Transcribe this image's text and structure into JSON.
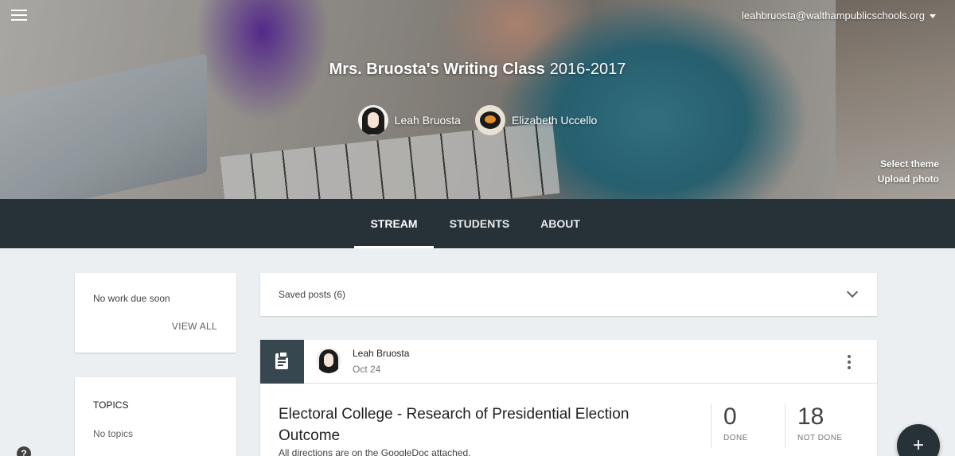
{
  "header": {
    "account_email": "leahbruosta@walthampublicschools.org",
    "class_name": "Mrs. Bruosta's Writing Class",
    "class_section": "2016-2017",
    "teachers": [
      {
        "name": "Leah Bruosta"
      },
      {
        "name": "Elizabeth Uccello"
      }
    ],
    "select_theme": "Select theme",
    "upload_photo": "Upload photo"
  },
  "tabs": [
    {
      "label": "STREAM",
      "active": true
    },
    {
      "label": "STUDENTS",
      "active": false
    },
    {
      "label": "ABOUT",
      "active": false
    }
  ],
  "upcoming": {
    "text": "No work due soon",
    "view_all": "VIEW ALL"
  },
  "topics": {
    "heading": "TOPICS",
    "empty": "No topics"
  },
  "saved_posts": {
    "label": "Saved posts (6)"
  },
  "post": {
    "author": "Leah Bruosta",
    "date": "Oct 24",
    "title": "Electoral College - Research of Presidential Election Outcome",
    "description": "All directions are on the GoogleDoc attached.",
    "done_count": "0",
    "done_label": "DONE",
    "not_done_count": "18",
    "not_done_label": "NOT DONE"
  },
  "fab_symbol": "+",
  "help_symbol": "?",
  "colors": {
    "nav_bg": "#263238",
    "page_bg": "#eceff1",
    "assignment_block": "#37474f"
  }
}
